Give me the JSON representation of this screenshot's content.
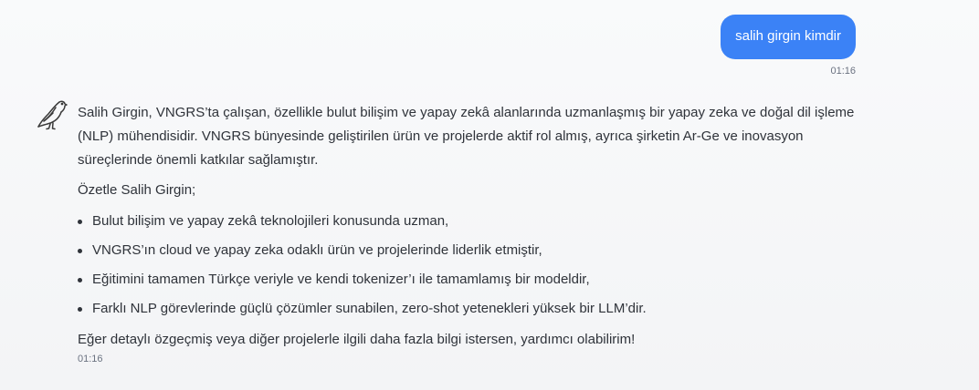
{
  "user_message": {
    "text": "salih girgin kimdir",
    "time": "01:16"
  },
  "assistant_message": {
    "avatar_icon": "bird-icon",
    "intro": "Salih Girgin, VNGRS’ta çalışan, özellikle bulut bilişim ve yapay zekâ alanlarında uzmanlaşmış bir yapay zeka ve doğal dil işleme (NLP) mühendisidir. VNGRS bünyesinde geliştirilen ürün ve projelerde aktif rol almış, ayrıca şirketin Ar-Ge ve inovasyon süreçlerinde önemli katkılar sağlamıştır.",
    "summary_title": "Özetle Salih Girgin;",
    "bullets": [
      "Bulut bilişim ve yapay zekâ teknolojileri konusunda uzman,",
      "VNGRS’ın cloud ve yapay zeka odaklı ürün ve projelerinde liderlik etmiştir,",
      "Eğitimini tamamen Türkçe veriyle ve kendi tokenizer’ı ile tamamlamış bir modeldir,",
      "Farklı NLP görevlerinde güçlü çözümler sunabilen, zero-shot yetenekleri yüksek bir LLM’dir."
    ],
    "closing": "Eğer detaylı özgeçmiş veya diğer projelerle ilgili daha fazla bilgi istersen, yardımcı olabilirim!",
    "time": "01:16"
  },
  "colors": {
    "user_bubble": "#3b82f6",
    "text": "#2f333a",
    "timestamp": "#6b7280"
  }
}
